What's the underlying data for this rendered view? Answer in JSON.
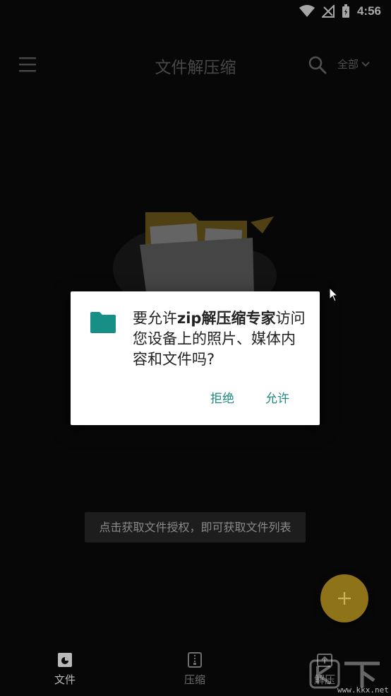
{
  "status_bar": {
    "time": "4:56"
  },
  "app_bar": {
    "title": "文件解压缩",
    "filter_label": "全部"
  },
  "dialog": {
    "message_prefix": "要允许",
    "app_name": "zip解压缩专家",
    "message_rest": "访问您设备上的照片、媒体内容和文件吗?",
    "deny_label": "拒绝",
    "allow_label": "允许"
  },
  "hint": {
    "text": "点击获取文件授权，即可获取文件列表"
  },
  "fab": {
    "icon": "plus-icon"
  },
  "bottom_nav": {
    "items": [
      {
        "label": "文件",
        "icon": "file-icon",
        "active": true
      },
      {
        "label": "压缩",
        "icon": "zip-icon",
        "active": false
      },
      {
        "label": "解压",
        "icon": "extract-icon",
        "active": false
      }
    ]
  },
  "watermark": {
    "url": "www.kkx.net"
  },
  "colors": {
    "accent": "#8e7319",
    "dialog_button": "#1f8a82",
    "folder_icon": "#178f86",
    "background": "#0b0b0b"
  }
}
